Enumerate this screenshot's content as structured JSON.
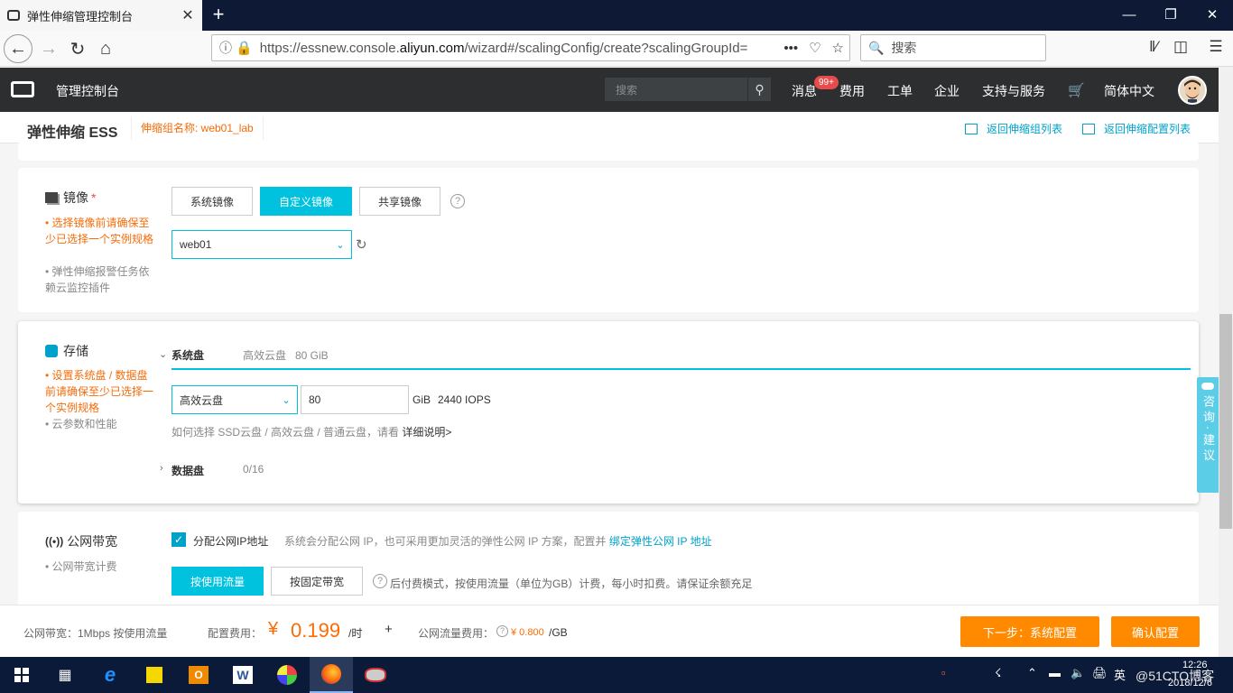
{
  "browser": {
    "tab_title": "弹性伸缩管理控制台",
    "tab_close": "✕",
    "new_tab": "+",
    "url_prefix": "https://essnew.console.",
    "url_domain": "aliyun.com",
    "url_suffix": "/wizard#/scalingConfig/create?scalingGroupId=",
    "search_placeholder": "搜索",
    "more": "•••"
  },
  "console": {
    "title": "管理控制台",
    "search_placeholder": "搜索",
    "nav": {
      "messages": "消息",
      "badge": "99+",
      "billing": "费用",
      "tickets": "工单",
      "enterprise": "企业",
      "support": "支持与服务",
      "language": "简体中文"
    }
  },
  "product": {
    "name": "弹性伸缩 ESS",
    "group_label": "伸缩组名称: web01_lab",
    "back_group_list": "返回伸缩组列表",
    "back_config_list": "返回伸缩配置列表"
  },
  "image_section": {
    "title": "镜像",
    "required_mark": "*",
    "tip1": "选择镜像前请确保至少已选择一个实例规格",
    "tip2": "弹性伸缩报警任务依赖云监控插件",
    "tabs": [
      "系统镜像",
      "自定义镜像",
      "共享镜像"
    ],
    "selected_tab": "自定义镜像",
    "help": "?",
    "selected_image": "web01"
  },
  "storage_section": {
    "title": "存储",
    "tip1": "设置系统盘 / 数据盘前请确保至少已选择一个实例规格",
    "tip2": "云参数和性能",
    "system_disk_label": "系统盘",
    "system_disk_summary": "高效云盘   80 GiB",
    "disk_type": "高效云盘",
    "disk_size": "80",
    "unit": "GiB",
    "iops": "2440 IOPS",
    "help_text": "如何选择 SSD云盘 / 高效云盘 / 普通云盘，请看",
    "help_link": "详细说明>",
    "data_disk_label": "数据盘",
    "data_disk_count": "0/16"
  },
  "network_section": {
    "title": "公网带宽",
    "tip1": "公网带宽计费",
    "checkbox_label": "分配公网IP地址",
    "checked": true,
    "desc": "系统会分配公网 IP，也可采用更加灵活的弹性公网 IP 方案，配置并",
    "desc_link": "绑定弹性公网 IP 地址",
    "mode_buttons": [
      "按使用流量",
      "按固定带宽"
    ],
    "selected_mode": "按使用流量",
    "mode_desc": "后付费模式，按使用流量（单位为GB）计费，每小时扣费。请保证余额充足"
  },
  "footer": {
    "bandwidth": "公网带宽：1Mbps 按使用流量",
    "fee_label": "配置费用：",
    "currency": "¥",
    "price": "0.199",
    "per_hour": "/时",
    "plus": "+",
    "traffic_label": "公网流量费用：",
    "traffic_price": "¥ 0.800",
    "per_gb": "/GB",
    "next_button": "下一步：系统配置",
    "confirm_button": "确认配置"
  },
  "feedback": {
    "label": "咨询·建议"
  },
  "taskbar": {
    "ime": "英",
    "time": "12:26",
    "date": "2018/12/6",
    "watermark": "@51CTO博客"
  },
  "colors": {
    "accent": "#00c1de",
    "orange": "#ff8a00",
    "console_header": "#2c2e30"
  }
}
